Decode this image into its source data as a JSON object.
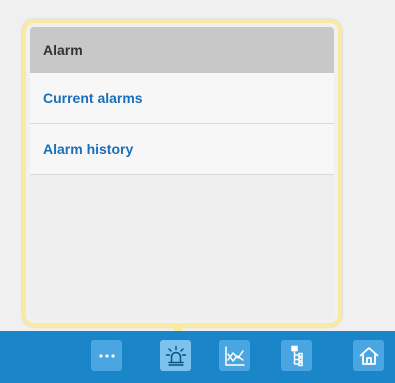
{
  "popup": {
    "header": "Alarm",
    "items": [
      {
        "label": "Current alarms"
      },
      {
        "label": "Alarm history"
      }
    ]
  },
  "toolbar": {
    "buttons": [
      {
        "icon": "more-icon",
        "active": false
      },
      {
        "icon": "alarm-light-icon",
        "active": true
      },
      {
        "icon": "trend-chart-icon",
        "active": false
      },
      {
        "icon": "tree-structure-icon",
        "active": false
      },
      {
        "icon": "home-icon",
        "active": false
      }
    ]
  },
  "colors": {
    "toolbar_bg": "#1a85c9",
    "button_bg": "#4aa6e0",
    "button_active_bg": "#7cc2ef",
    "popup_border": "#fbe9a0",
    "link_text": "#1b6fb8",
    "header_bg": "#c8c8c8"
  }
}
